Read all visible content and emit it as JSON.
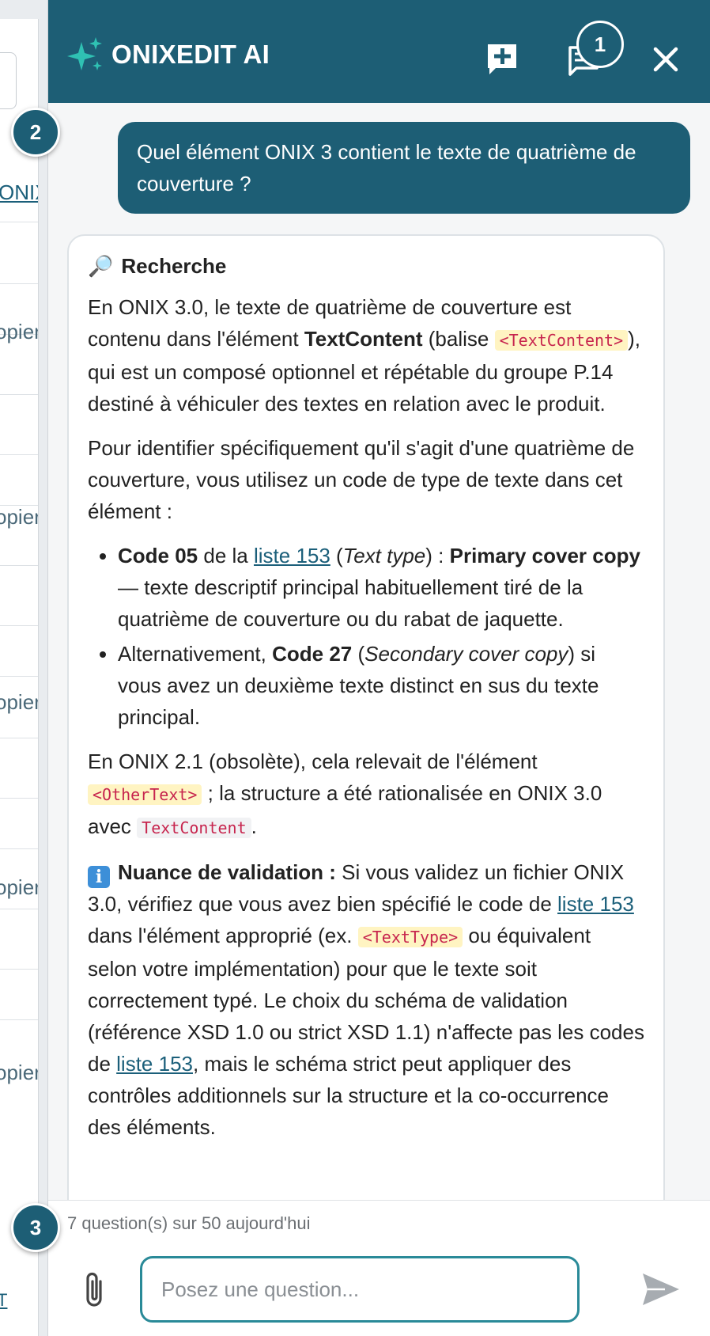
{
  "background_app": {
    "link_label": "ONIX",
    "copy_labels": [
      "opier",
      "opier",
      "opier",
      "opier",
      "opier"
    ],
    "bottom_link": "T"
  },
  "header": {
    "title": "ONIXEDIT AI",
    "history_count": "1"
  },
  "messages": {
    "user_question": "Quel élément ONIX 3 contient le texte de quatrième de couverture ?",
    "answer": {
      "section_emoji": "🔎",
      "section_title": "Recherche",
      "p1": {
        "t1": "En ONIX 3.0, le texte de quatrième de couverture est contenu dans l'élément ",
        "b1": "TextContent",
        "t2": " (balise ",
        "code1": "<TextContent>",
        "t3": "), qui est un composé optionnel et répétable du groupe P.14 destiné à véhiculer des textes en relation avec le produit."
      },
      "p2": "Pour identifier spécifiquement qu'il s'agit d'une quatrième de couverture, vous utilisez un code de type de texte dans cet élément :",
      "bullet1": {
        "b1": "Code 05",
        "t1": " de la ",
        "link": "liste 153",
        "t2": " (",
        "i1": "Text type",
        "t3": ") : ",
        "b2": "Primary cover copy",
        "t4": " — texte descriptif principal habituellement tiré de la quatrième de couverture ou du rabat de jaquette."
      },
      "bullet2": {
        "t1": "Alternativement, ",
        "b1": "Code 27",
        "t2": " (",
        "i1": "Secondary cover copy",
        "t3": ") si vous avez un deuxième texte distinct en sus du texte principal."
      },
      "p3": {
        "t1": "En ONIX 2.1 (obsolète), cela relevait de l'élément ",
        "code1": "<OtherText>",
        "t2": " ; la structure a été rationalisée en ONIX 3.0 avec ",
        "code2": "TextContent",
        "t3": "."
      },
      "p4": {
        "icon": "i",
        "b1": "Nuance de validation :",
        "t1": " Si vous validez un fichier ONIX 3.0, vérifiez que vous avez bien spécifié le code de ",
        "link1": "liste 153",
        "t2": " dans l'élément approprié (ex. ",
        "code1": "<TextType>",
        "t3": " ou équivalent selon votre implémentation) pour que le texte soit correctement typé. Le choix du schéma de validation (référence XSD 1.0 ou strict XSD 1.1) n'affecte pas les codes de ",
        "link2": "liste 153",
        "t4": ", mais le schéma strict peut appliquer des contrôles additionnels sur la structure et la co-occurrence des éléments."
      }
    }
  },
  "footer": {
    "quota": "7 question(s) sur 50 aujourd'hui",
    "input_placeholder": "Posez une question..."
  },
  "tour_markers": [
    "1",
    "2",
    "3"
  ],
  "colors": {
    "brand": "#1d5e75",
    "input_border": "#2a8a98",
    "link": "#1b5f7a",
    "code_text": "#c7254e",
    "code_bg": "#fff4c2"
  }
}
